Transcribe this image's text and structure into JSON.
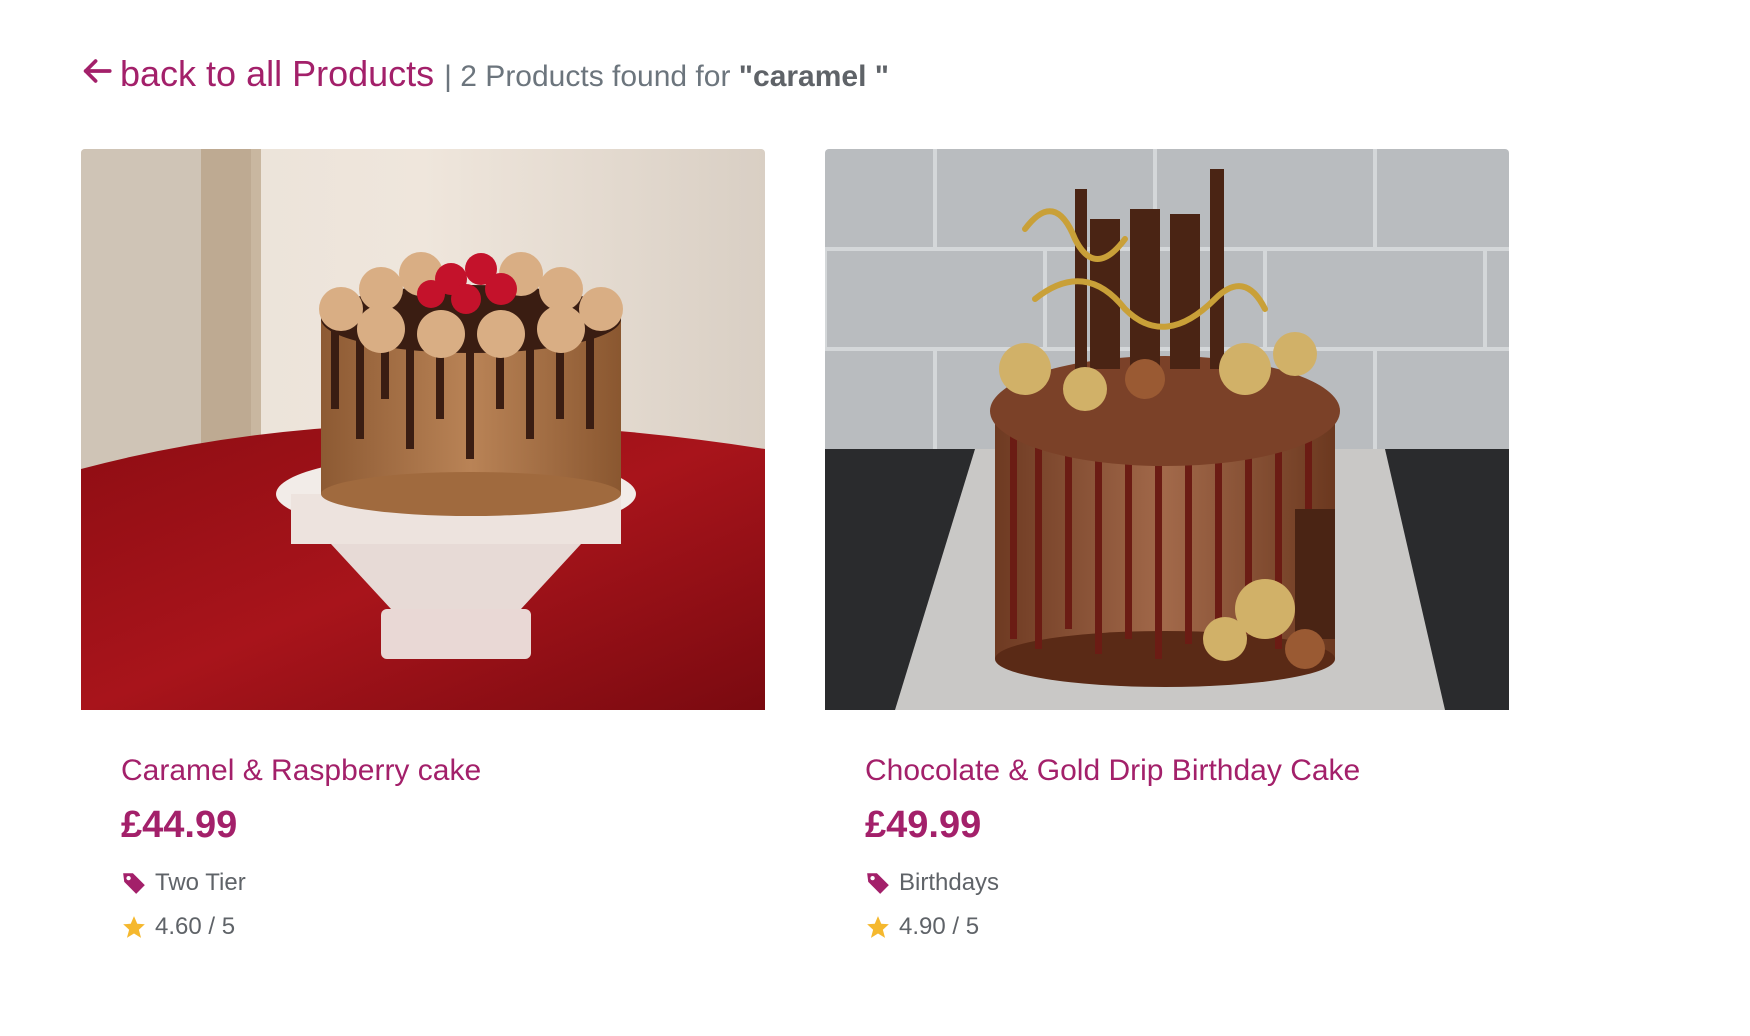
{
  "header": {
    "back_label": "back to all Products",
    "results_prefix": "| 2 Products found for ",
    "query": "\"caramel \""
  },
  "colors": {
    "accent": "#a3206a",
    "muted_text": "#6c757d",
    "star": "#f5b82e"
  },
  "products": [
    {
      "name": "Caramel & Raspberry cake",
      "price": "£44.99",
      "category": "Two Tier",
      "rating": "4.60 / 5"
    },
    {
      "name": "Chocolate & Gold Drip Birthday Cake",
      "price": "£49.99",
      "category": "Birthdays",
      "rating": "4.90 / 5"
    }
  ],
  "icons": {
    "back": "arrow-left-icon",
    "category": "tag-icon",
    "rating": "star-icon"
  }
}
